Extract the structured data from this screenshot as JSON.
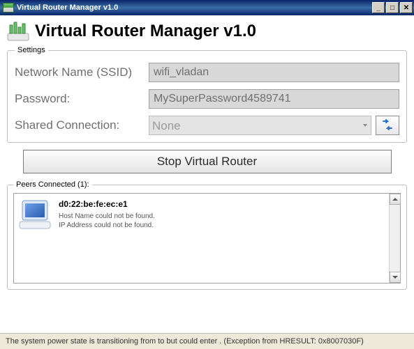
{
  "window": {
    "title": "Virtual Router Manager v1.0"
  },
  "header": {
    "title": "Virtual Router Manager v1.0"
  },
  "settings": {
    "legend": "Settings",
    "ssid_label": "Network Name (SSID)",
    "ssid_value": "wifi_vladan",
    "password_label": "Password:",
    "password_value": "MySuperPassword4589741",
    "connection_label": "Shared Connection:",
    "connection_value": "None"
  },
  "actions": {
    "stop_label": "Stop Virtual Router"
  },
  "peers": {
    "legend": "Peers Connected (1):",
    "items": [
      {
        "mac": "d0:22:be:fe:ec:e1",
        "hostname_msg": "Host Name could not be found.",
        "ip_msg": "IP Address could not be found."
      }
    ]
  },
  "status": {
    "text": "The system power state is transitioning from  to  but could enter . (Exception from HRESULT: 0x8007030F)"
  }
}
